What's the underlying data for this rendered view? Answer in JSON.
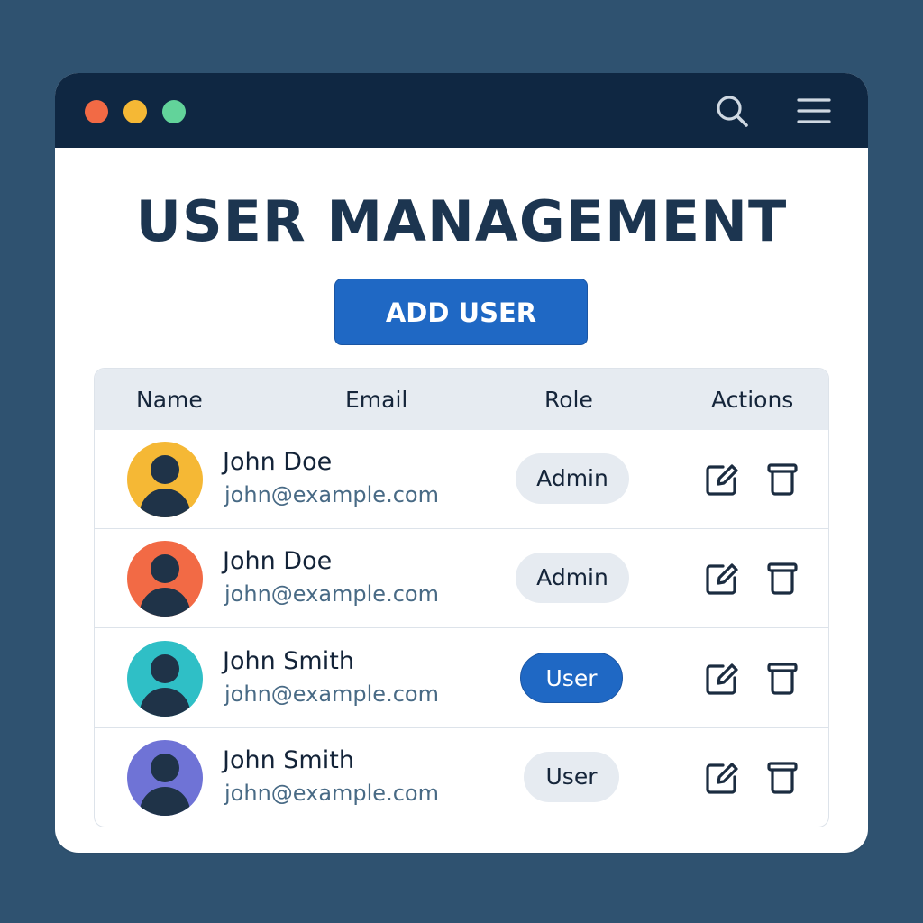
{
  "window": {
    "controls": [
      "close",
      "minimize",
      "maximize"
    ],
    "toolbar_icons": [
      "search-icon",
      "menu-icon"
    ]
  },
  "page": {
    "title": "USER MANAGEMENT",
    "add_user_label": "ADD USER"
  },
  "table": {
    "columns": [
      "Name",
      "Email",
      "Role",
      "Actions"
    ],
    "rows": [
      {
        "name": "John Doe",
        "email": "john@example.com",
        "role": "Admin",
        "avatar_color": "#f5b835",
        "role_highlighted": false
      },
      {
        "name": "John Doe",
        "email": "john@example.com",
        "role": "Admin",
        "avatar_color": "#f26a45",
        "role_highlighted": false
      },
      {
        "name": "John Smith",
        "email": "john@example.com",
        "role": "User",
        "avatar_color": "#2fbfc6",
        "role_highlighted": true
      },
      {
        "name": "John Smith",
        "email": "john@example.com",
        "role": "User",
        "avatar_color": "#6f73d6",
        "role_highlighted": false
      }
    ],
    "row_actions": [
      "edit-icon",
      "delete-icon"
    ]
  },
  "colors": {
    "background": "#2f5270",
    "titlebar": "#0f2742",
    "accent": "#1f68c4",
    "title_text": "#1c3550",
    "header_bg": "#e6ebf1"
  }
}
